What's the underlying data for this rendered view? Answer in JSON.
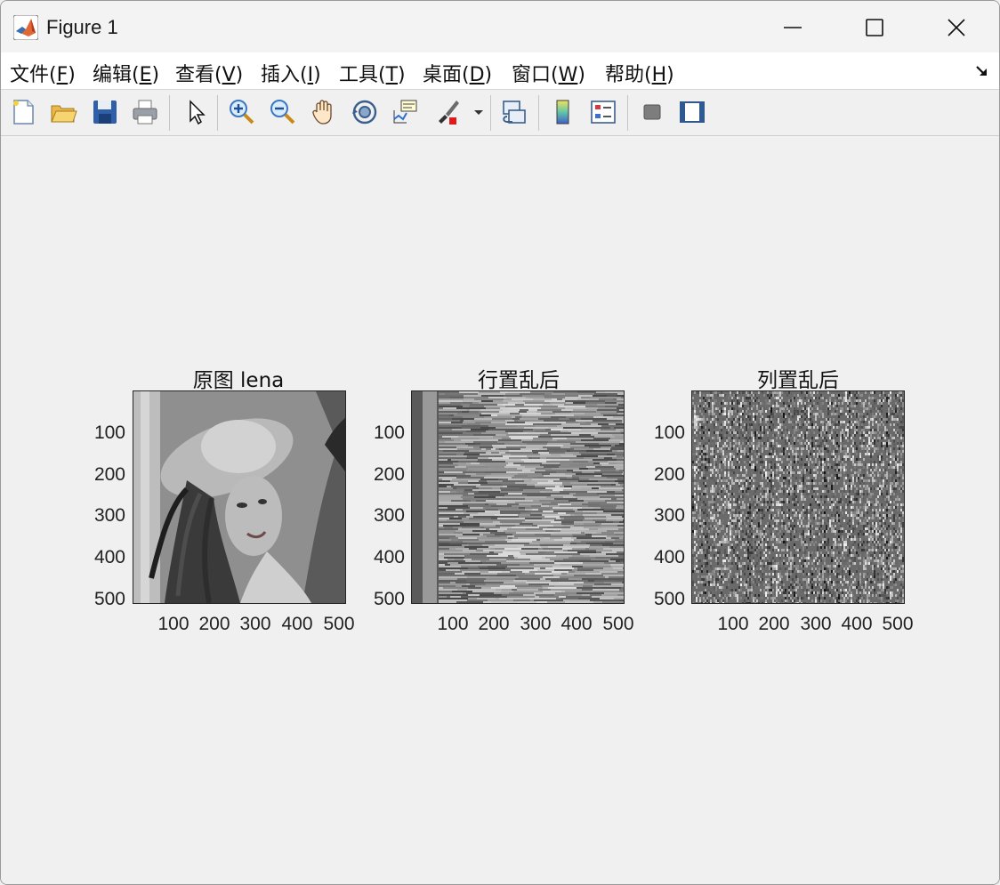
{
  "window": {
    "title": "Figure 1"
  },
  "menubar": {
    "items": [
      {
        "label": "文件(",
        "key": "F",
        "tail": ")"
      },
      {
        "label": "编辑(",
        "key": "E",
        "tail": ")"
      },
      {
        "label": "查看(",
        "key": "V",
        "tail": ")"
      },
      {
        "label": "插入(",
        "key": "I",
        "tail": ")"
      },
      {
        "label": "工具(",
        "key": "T",
        "tail": ")"
      },
      {
        "label": "桌面(",
        "key": "D",
        "tail": ")"
      },
      {
        "label": "窗口(",
        "key": "W",
        "tail": ")"
      },
      {
        "label": "帮助(",
        "key": "H",
        "tail": ")"
      }
    ]
  },
  "toolbar": {
    "icons": [
      "new-figure-icon",
      "open-file-icon",
      "save-icon",
      "print-icon",
      "select-pointer-icon",
      "zoom-in-icon",
      "zoom-out-icon",
      "pan-hand-icon",
      "rotate-3d-icon",
      "data-cursor-icon",
      "brush-icon",
      "link-plot-icon",
      "colorbar-icon",
      "legend-icon",
      "hide-plot-tools-icon",
      "show-plot-tools-icon"
    ]
  },
  "figure": {
    "axes": [
      {
        "title": "原图 lena",
        "image": "lena grayscale original"
      },
      {
        "title": "行置乱后",
        "image": "row-scrambled noise stripes"
      },
      {
        "title": "列置乱后",
        "image": "column-scrambled noise"
      }
    ],
    "yticks": [
      "100",
      "200",
      "300",
      "400",
      "500"
    ],
    "xticks": [
      "100",
      "200",
      "300",
      "400",
      "500"
    ]
  },
  "colors": {
    "background": "#f0f0f0",
    "menubar": "#ffffff",
    "matlab_orange": "#e16737",
    "matlab_blue": "#3a6fb0"
  }
}
